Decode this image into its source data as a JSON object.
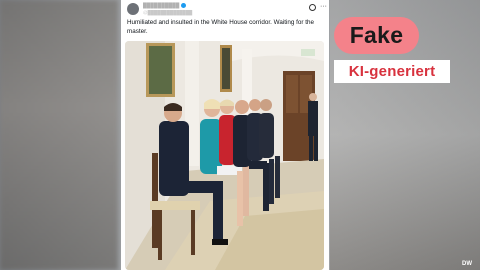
{
  "post": {
    "user_name": "██████████",
    "user_handle": "@██████████████",
    "text": "Humiliated and insulted in the White House corridor. Waiting for the master."
  },
  "photo": {
    "description_icon": "photo-icon",
    "people_count": 6
  },
  "labels": {
    "fake": "Fake",
    "ki": "KI-generiert"
  },
  "colors": {
    "fake_badge": "#f4828a",
    "ki_text": "#d8323e",
    "card_bg": "#ffffff"
  },
  "brand": {
    "logo": "DW"
  }
}
